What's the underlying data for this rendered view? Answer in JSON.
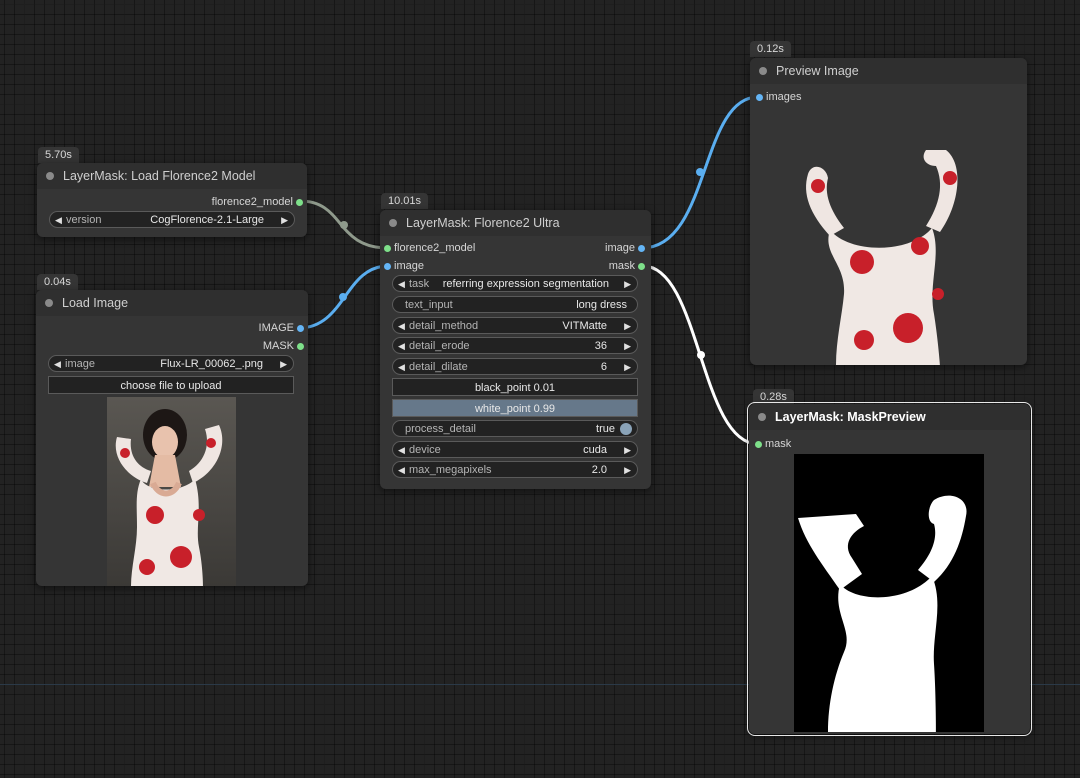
{
  "nodes": {
    "load_florence2": {
      "time": "5.70s",
      "title": "LayerMask: Load Florence2 Model",
      "output": "florence2_model",
      "widgets": {
        "version_label": "version",
        "version_value": "CogFlorence-2.1-Large"
      }
    },
    "load_image": {
      "time": "0.04s",
      "title": "Load Image",
      "outputs": [
        "IMAGE",
        "MASK"
      ],
      "widgets": {
        "image_label": "image",
        "image_value": "Flux-LR_00062_.png",
        "upload_label": "choose file to upload"
      }
    },
    "florence2_ultra": {
      "time": "10.01s",
      "title": "LayerMask: Florence2 Ultra",
      "inputs": [
        "florence2_model",
        "image"
      ],
      "outputs": [
        "image",
        "mask"
      ],
      "widgets": {
        "task_label": "task",
        "task_value": "referring expression segmentation",
        "text_input_label": "text_input",
        "text_input_value": "long dress",
        "detail_method_label": "detail_method",
        "detail_method_value": "VITMatte",
        "detail_erode_label": "detail_erode",
        "detail_erode_value": "36",
        "detail_dilate_label": "detail_dilate",
        "detail_dilate_value": "6",
        "black_point": "black_point  0.01",
        "white_point": "white_point  0.99",
        "process_detail_label": "process_detail",
        "process_detail_value": "true",
        "device_label": "device",
        "device_value": "cuda",
        "max_megapixels_label": "max_megapixels",
        "max_megapixels_value": "2.0"
      }
    },
    "preview_image": {
      "time": "0.12s",
      "title": "Preview Image",
      "input": "images"
    },
    "mask_preview": {
      "time": "0.28s",
      "title": "LayerMask: MaskPreview",
      "input": "mask"
    }
  },
  "colors": {
    "canvas": "#222222",
    "node_body": "#353535",
    "image_link": "#64b5f6",
    "mask_link": "#ffffff",
    "model_link": "#8f9a8c",
    "white_point_fill": "#66788a"
  }
}
